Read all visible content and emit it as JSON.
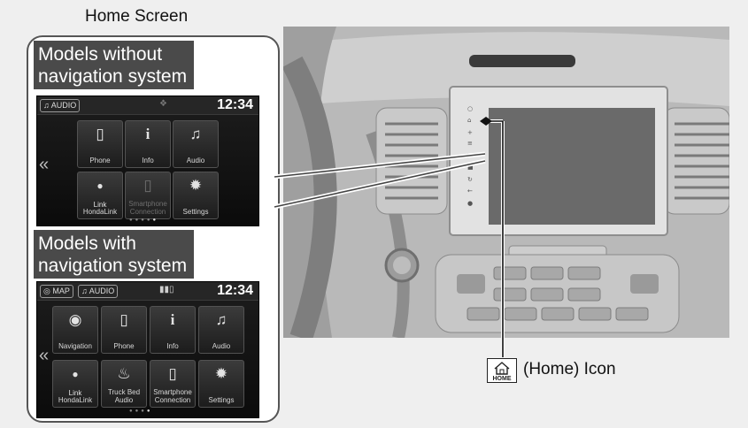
{
  "figure": {
    "title": "Home Screen",
    "callout_label": "(Home) Icon",
    "home_icon_text": "HOME"
  },
  "panel_top": {
    "heading_line1": "Models without",
    "heading_line2": "navigation system",
    "screen": {
      "source_chip": "AUDIO",
      "clock": "12:34",
      "tiles": [
        {
          "label": "Phone",
          "icon": "phone-icon"
        },
        {
          "label": "Info",
          "icon": "info-icon"
        },
        {
          "label": "Audio",
          "icon": "music-note-icon"
        },
        {
          "label": "HondaLink",
          "icon": "hondalink-icon"
        },
        {
          "label": "Smartphone Connection",
          "icon": "smartphone-icon"
        },
        {
          "label": "Settings",
          "icon": "gear-icon"
        }
      ]
    }
  },
  "panel_bottom": {
    "heading_line1": "Models with",
    "heading_line2": "navigation system",
    "screen": {
      "map_chip": "MAP",
      "source_chip": "AUDIO",
      "clock": "12:34",
      "tiles": [
        {
          "label": "Navigation",
          "icon": "navigation-icon"
        },
        {
          "label": "Phone",
          "icon": "phone-icon"
        },
        {
          "label": "Info",
          "icon": "info-icon"
        },
        {
          "label": "Audio",
          "icon": "music-note-icon"
        },
        {
          "label": "HondaLink",
          "icon": "hondalink-icon"
        },
        {
          "label": "Truck Bed Audio",
          "icon": "truck-bed-audio-icon"
        },
        {
          "label": "Smartphone Connection",
          "icon": "smartphone-icon"
        },
        {
          "label": "Settings",
          "icon": "gear-icon"
        }
      ]
    }
  },
  "colors": {
    "band": "#4a4a4a",
    "screen": "#111111",
    "panel_border": "#555555"
  }
}
